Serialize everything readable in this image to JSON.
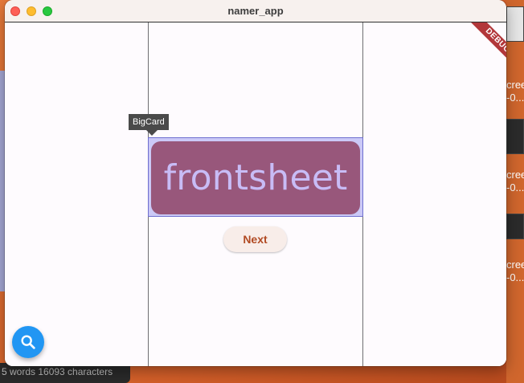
{
  "window": {
    "title": "namer_app"
  },
  "debug_banner": {
    "label": "DEBUG"
  },
  "inspector": {
    "tooltip": "BigCard"
  },
  "big_card": {
    "word": "frontsheet"
  },
  "actions": {
    "next_label": "Next"
  },
  "fab": {
    "icon": "search-icon",
    "color": "#2196f3"
  },
  "background": {
    "status_text": "5 words   16093 characters",
    "right_labels": [
      "cree",
      "-0...",
      "cree",
      "-0...",
      "cree",
      "-0..."
    ]
  },
  "colors": {
    "card_background": "#98577b",
    "card_text": "#c8bcf6",
    "button_text": "#b14a23",
    "highlight": "#a0a0f0"
  }
}
